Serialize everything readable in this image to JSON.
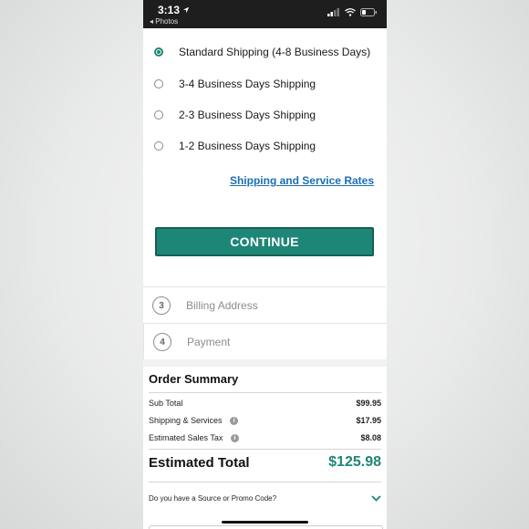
{
  "status_bar": {
    "time": "3:13",
    "back_label": "◂ Photos"
  },
  "shipping_options": [
    {
      "label": "Standard Shipping (4-8 Business Days)",
      "selected": true
    },
    {
      "label": "3-4 Business Days Shipping",
      "selected": false
    },
    {
      "label": "2-3 Business Days Shipping",
      "selected": false
    },
    {
      "label": "1-2 Business Days Shipping",
      "selected": false
    }
  ],
  "rates_link": "Shipping and Service Rates",
  "continue_label": "CONTINUE",
  "steps": [
    {
      "number": "3",
      "label": "Billing Address"
    },
    {
      "number": "4",
      "label": "Payment"
    }
  ],
  "order_summary": {
    "title": "Order Summary",
    "lines": [
      {
        "label": "Sub Total",
        "value": "$99.95"
      },
      {
        "label": "Shipping & Services",
        "value": "$17.95"
      },
      {
        "label": "Estimated Sales Tax",
        "value": "$8.08"
      }
    ],
    "total_label": "Estimated Total",
    "total_value": "$125.98"
  },
  "promo": {
    "label": "Do you have a Source or Promo Code?"
  },
  "colors": {
    "accent": "#1e8676",
    "link": "#1c6fb5"
  }
}
